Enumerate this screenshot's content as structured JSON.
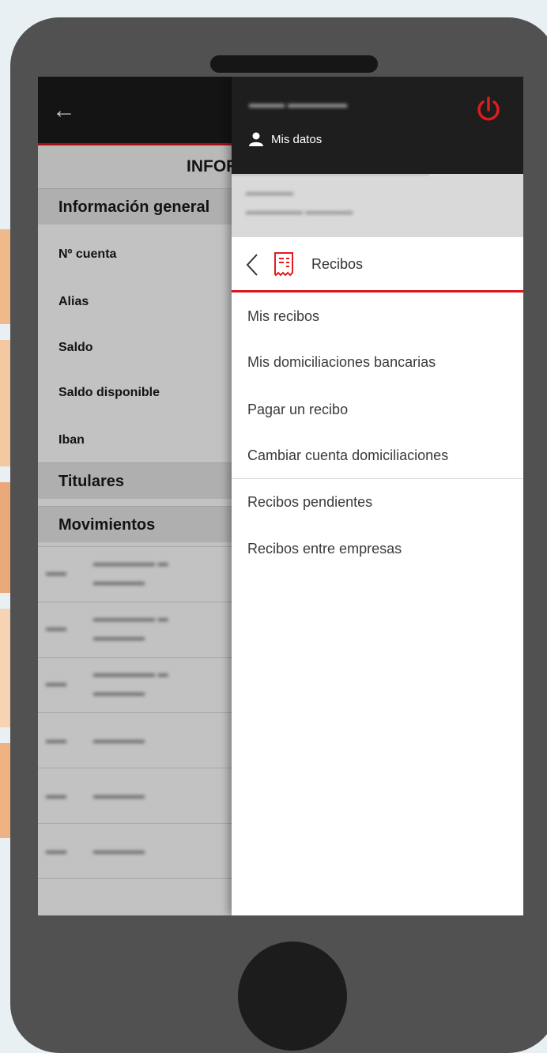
{
  "app": {
    "title": "INFORMA",
    "back_icon": "back-arrow-icon",
    "section_general": "Información general",
    "fields": [
      "Nº cuenta",
      "Alias",
      "Saldo",
      "Saldo disponible",
      "Iban"
    ],
    "section_titulares": "Titulares",
    "section_movimientos": "Movimientos"
  },
  "drawer": {
    "mis_datos": "Mis datos",
    "section_title": "Recibos",
    "items": [
      "Mis recibos",
      "Mis domiciliaciones bancarias",
      "Pagar un recibo",
      "Cambiar cuenta domiciliaciones",
      "Recibos pendientes",
      "Recibos entre empresas"
    ]
  },
  "colors": {
    "accent": "#d9141b",
    "header": "#1b1b1b",
    "phone_body": "#515151"
  }
}
